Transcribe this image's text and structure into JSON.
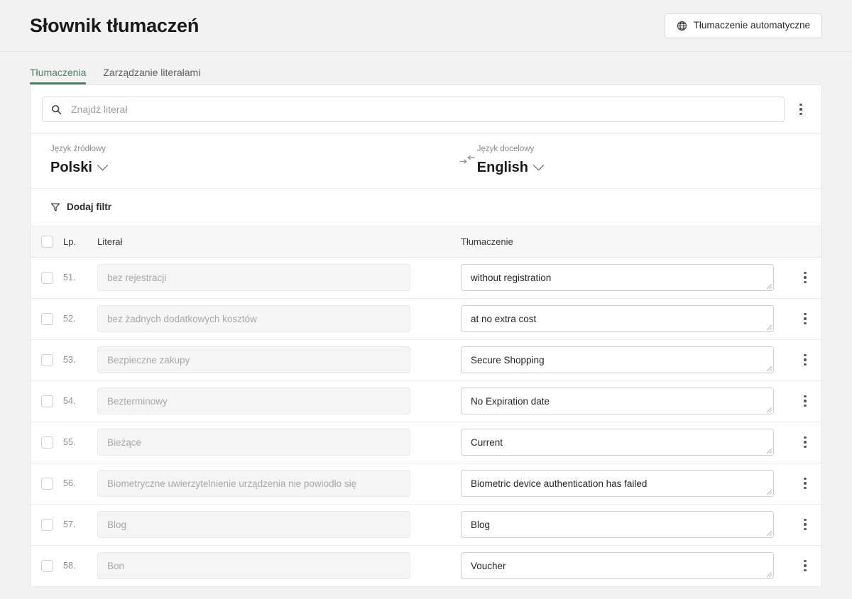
{
  "header": {
    "title": "Słownik tłumaczeń",
    "auto_translate_button": "Tłumaczenie automatyczne",
    "auto_translate_icon": "globe-icon"
  },
  "tabs": [
    {
      "label": "Tłumaczenia",
      "active": true
    },
    {
      "label": "Zarządzanie literałami",
      "active": false
    }
  ],
  "search": {
    "placeholder": "Znajdź literał",
    "value": "",
    "icon": "search-icon",
    "overflow_icon": "kebab-menu-icon"
  },
  "languages": {
    "source_label": "Język źródłowy",
    "source_value": "Polski",
    "target_label": "Język docelowy",
    "target_value": "English",
    "swap_icon": "swap-arrows-icon",
    "chevron_icon": "chevron-down-icon"
  },
  "filter": {
    "label": "Dodaj filtr",
    "icon": "filter-funnel-icon"
  },
  "table": {
    "columns": {
      "select_all": "",
      "number": "Lp.",
      "literal": "Literał",
      "translation": "Tłumaczenie"
    },
    "rows": [
      {
        "num": "51.",
        "literal": "bez rejestracji",
        "translation": "without registration"
      },
      {
        "num": "52.",
        "literal": "bez żadnych dodatkowych kosztów",
        "translation": "at no extra cost"
      },
      {
        "num": "53.",
        "literal": "Bezpieczne zakupy",
        "translation": "Secure Shopping"
      },
      {
        "num": "54.",
        "literal": "Bezterminowy",
        "translation": "No Expiration date"
      },
      {
        "num": "55.",
        "literal": "Bieżące",
        "translation": "Current"
      },
      {
        "num": "56.",
        "literal": "Biometryczne uwierzytelnienie urządzenia nie powiodło się",
        "translation": "Biometric device authentication has failed"
      },
      {
        "num": "57.",
        "literal": "Blog",
        "translation": "Blog"
      },
      {
        "num": "58.",
        "literal": "Bon",
        "translation": "Voucher"
      }
    ]
  },
  "colors": {
    "accent_green": "#4f7f62",
    "page_background": "#f2f2f2",
    "card_background": "#ffffff",
    "text_primary": "#1a1a1a",
    "text_muted": "#8f8f8f"
  }
}
